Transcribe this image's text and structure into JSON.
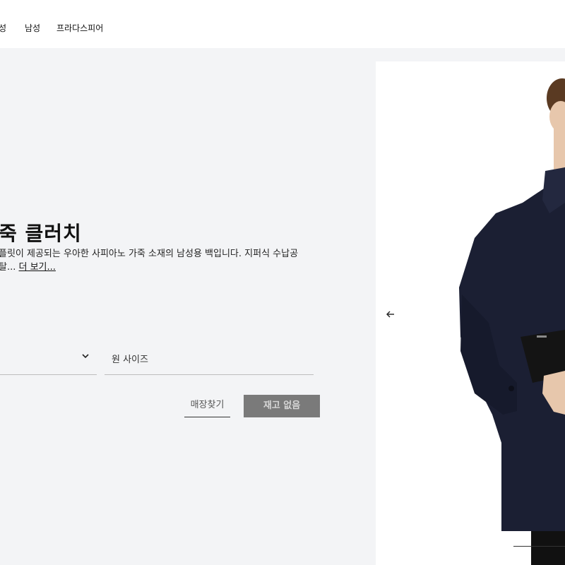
{
  "nav": {
    "items": [
      {
        "label": "성"
      },
      {
        "label": "남성"
      },
      {
        "label": "프라다스피어"
      }
    ]
  },
  "product": {
    "title": "죽 클러치",
    "description_line1": "플릿이 제공되는 우아한 사피아노 가죽 소재의 남성용 백입니다. 지퍼식 수납공",
    "description_line2_prefix": "탈... ",
    "more_label": "더 보기..."
  },
  "size": {
    "value": "원 사이즈"
  },
  "actions": {
    "store_label": "매장찾기",
    "out_of_stock_label": "재고 없음"
  },
  "icons": {
    "chevron": "chevron-down-icon",
    "arrow": "arrow-left-icon"
  },
  "colors": {
    "panel_bg": "#f3f4f6",
    "button_bg": "#7a7a7a",
    "coat": "#1b1f33"
  }
}
